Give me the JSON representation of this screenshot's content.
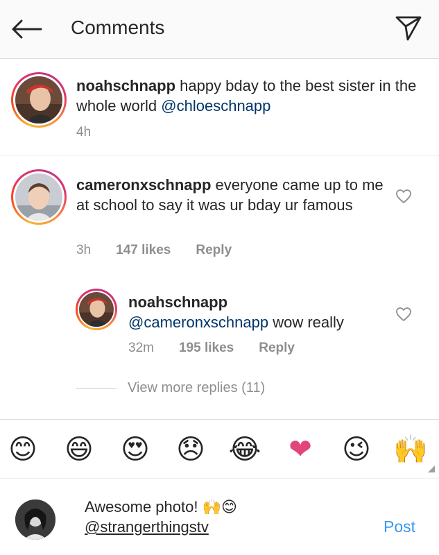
{
  "header": {
    "title": "Comments",
    "back_icon": "arrow-left-icon",
    "send_icon": "paper-plane-icon"
  },
  "caption": {
    "username": "noahschnapp",
    "text": " happy bday to the best sister in the whole world ",
    "mention": "@chloeschnapp",
    "time": "4h"
  },
  "comments": [
    {
      "username": "cameronxschnapp",
      "text": " everyone came up to me at school to say it was ur bday ur famous",
      "time": "3h",
      "likes": "147 likes",
      "reply": "Reply"
    },
    {
      "username": "noahschnapp",
      "mention": "@cameronxschnapp",
      "text": " wow really",
      "time": "32m",
      "likes": "195 likes",
      "reply": "Reply"
    }
  ],
  "view_more_replies": "View more replies (11)",
  "emoji_bar": [
    "😊",
    "😄",
    "😍",
    "😞",
    "😂",
    "❤",
    "😉",
    "🙌"
  ],
  "composer": {
    "text": "Awesome photo! 🙌😊",
    "tag": "@strangerthingstv",
    "post_label": "Post"
  },
  "colors": {
    "link": "#003569",
    "post": "#3897f0",
    "muted": "#8e8e8e",
    "heart_emoji": "#e0457b",
    "emoji_yellow": "#f8c42f"
  }
}
